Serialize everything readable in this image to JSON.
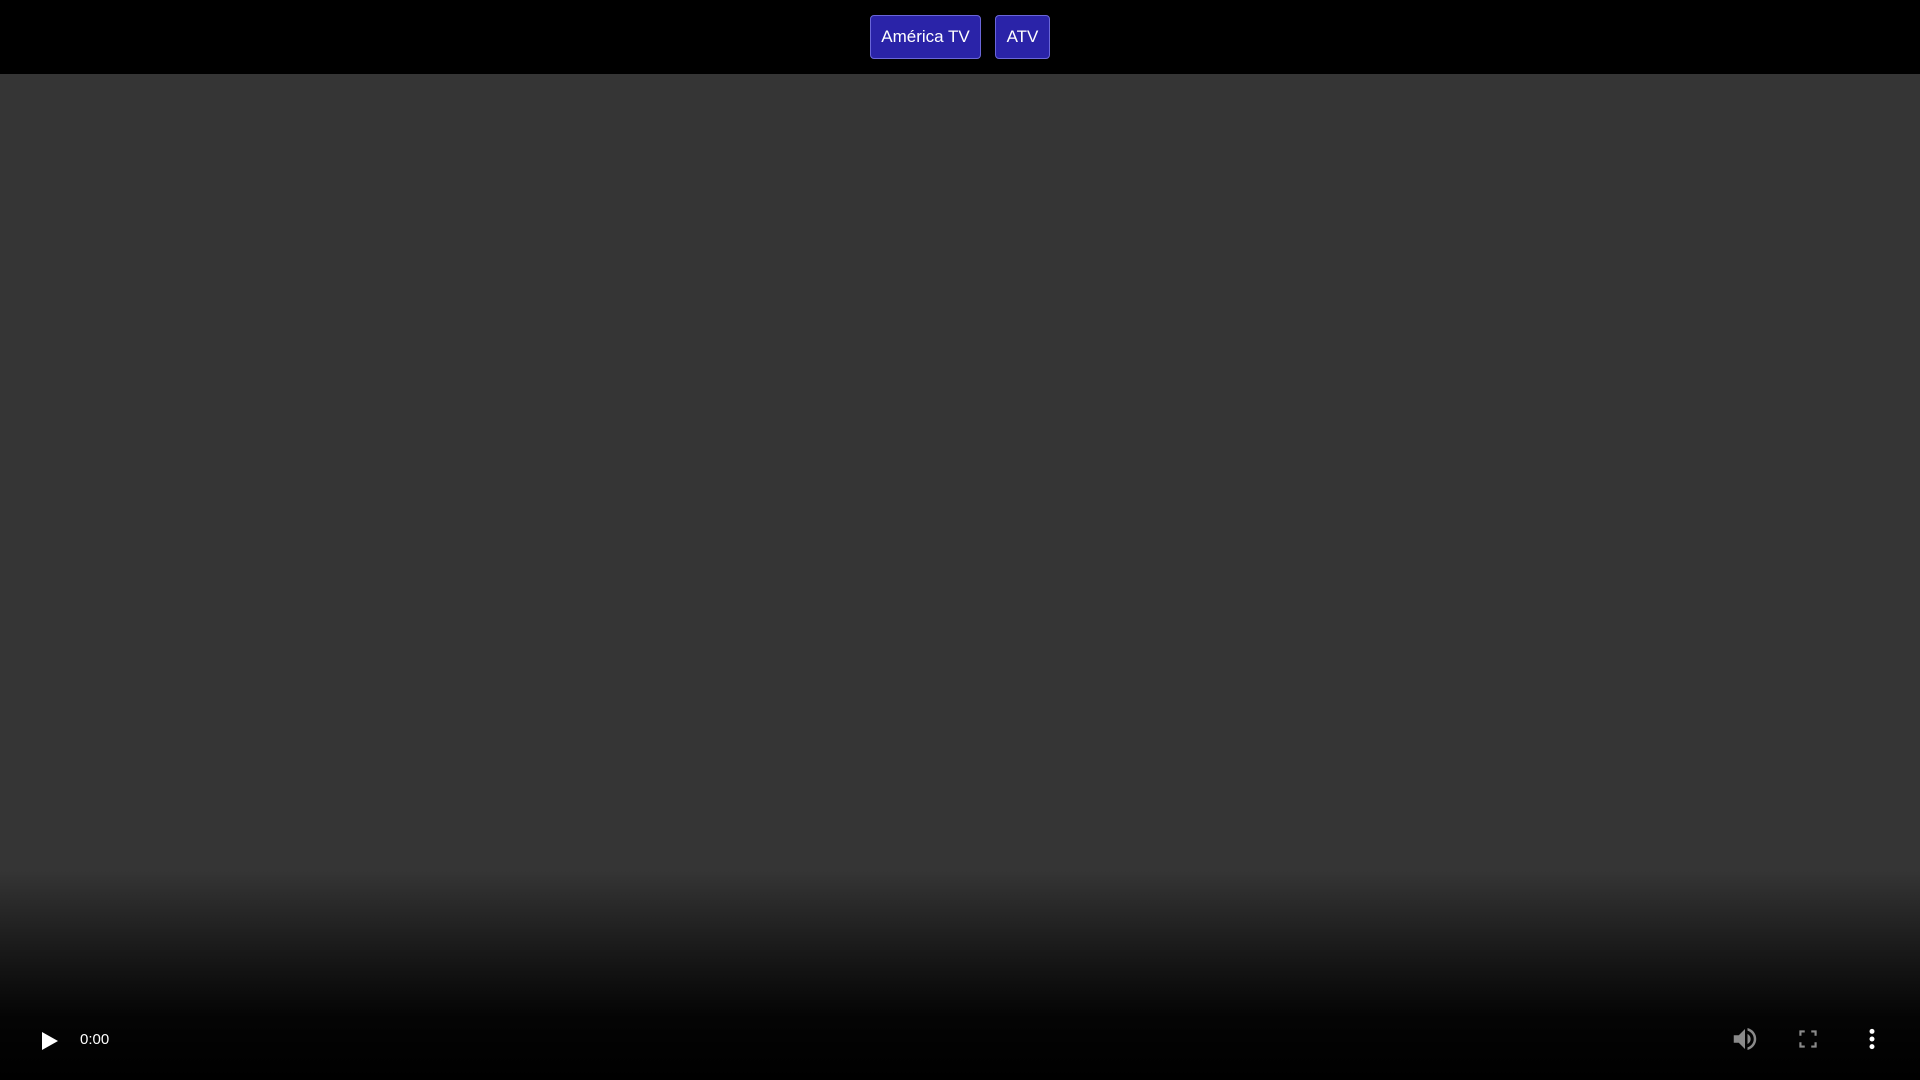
{
  "channels": {
    "america_label": "América TV",
    "atv_label": "ATV",
    "button_color": "#2a23a8"
  },
  "player": {
    "current_time": "0:00",
    "progress_fraction": 0,
    "icons": {
      "play": "play-icon",
      "volume": "volume-icon",
      "fullscreen": "fullscreen-icon",
      "more": "more-options-icon"
    }
  }
}
